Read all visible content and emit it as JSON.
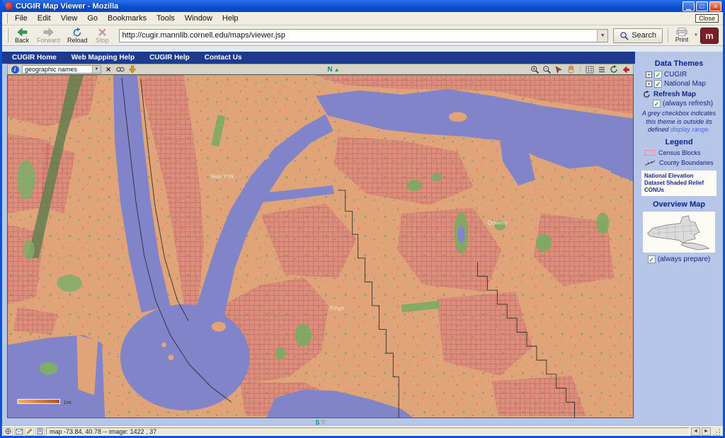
{
  "window": {
    "title": "CUGIR Map Viewer - Mozilla",
    "tooltip_close": "Close"
  },
  "menu": {
    "items": [
      "File",
      "Edit",
      "View",
      "Go",
      "Bookmarks",
      "Tools",
      "Window",
      "Help"
    ]
  },
  "toolbar": {
    "back": "Back",
    "forward": "Forward",
    "reload": "Reload",
    "stop": "Stop",
    "url": "http://cugir.mannlib.cornell.edu/maps/viewer.jsp",
    "search": "Search",
    "print": "Print"
  },
  "navbar": {
    "items": [
      "CUGIR Home",
      "Web Mapping Help",
      "CUGIR Help",
      "Contact Us"
    ]
  },
  "map_toolbar": {
    "layer_select": "geographic names",
    "north": "N",
    "north_glyph": "▲"
  },
  "map": {
    "labels": {
      "manhattan": "New York",
      "queens": "Queens",
      "kings": "Kings"
    },
    "scale": "1mi",
    "south": "S",
    "south_glyph": "▽"
  },
  "sidebar": {
    "data_themes": "Data Themes",
    "themes": [
      {
        "label": "CUGIR"
      },
      {
        "label": "National Map"
      }
    ],
    "refresh_map": "Refresh Map",
    "always_refresh": "(always refresh)",
    "note": "A grey checkbox indicates this theme is outside its defined",
    "note_link": "display range.",
    "legend": "Legend",
    "legend_census": "Census Blocks",
    "legend_county": "County Boundaries",
    "legend_ned": "National Elevation Dataset Shaded Relief CONUs",
    "overview": "Overview Map",
    "always_prepare": "(always prepare)"
  },
  "status": {
    "text": "map -73.84, 40.78 -- image: 1422 , 37"
  }
}
